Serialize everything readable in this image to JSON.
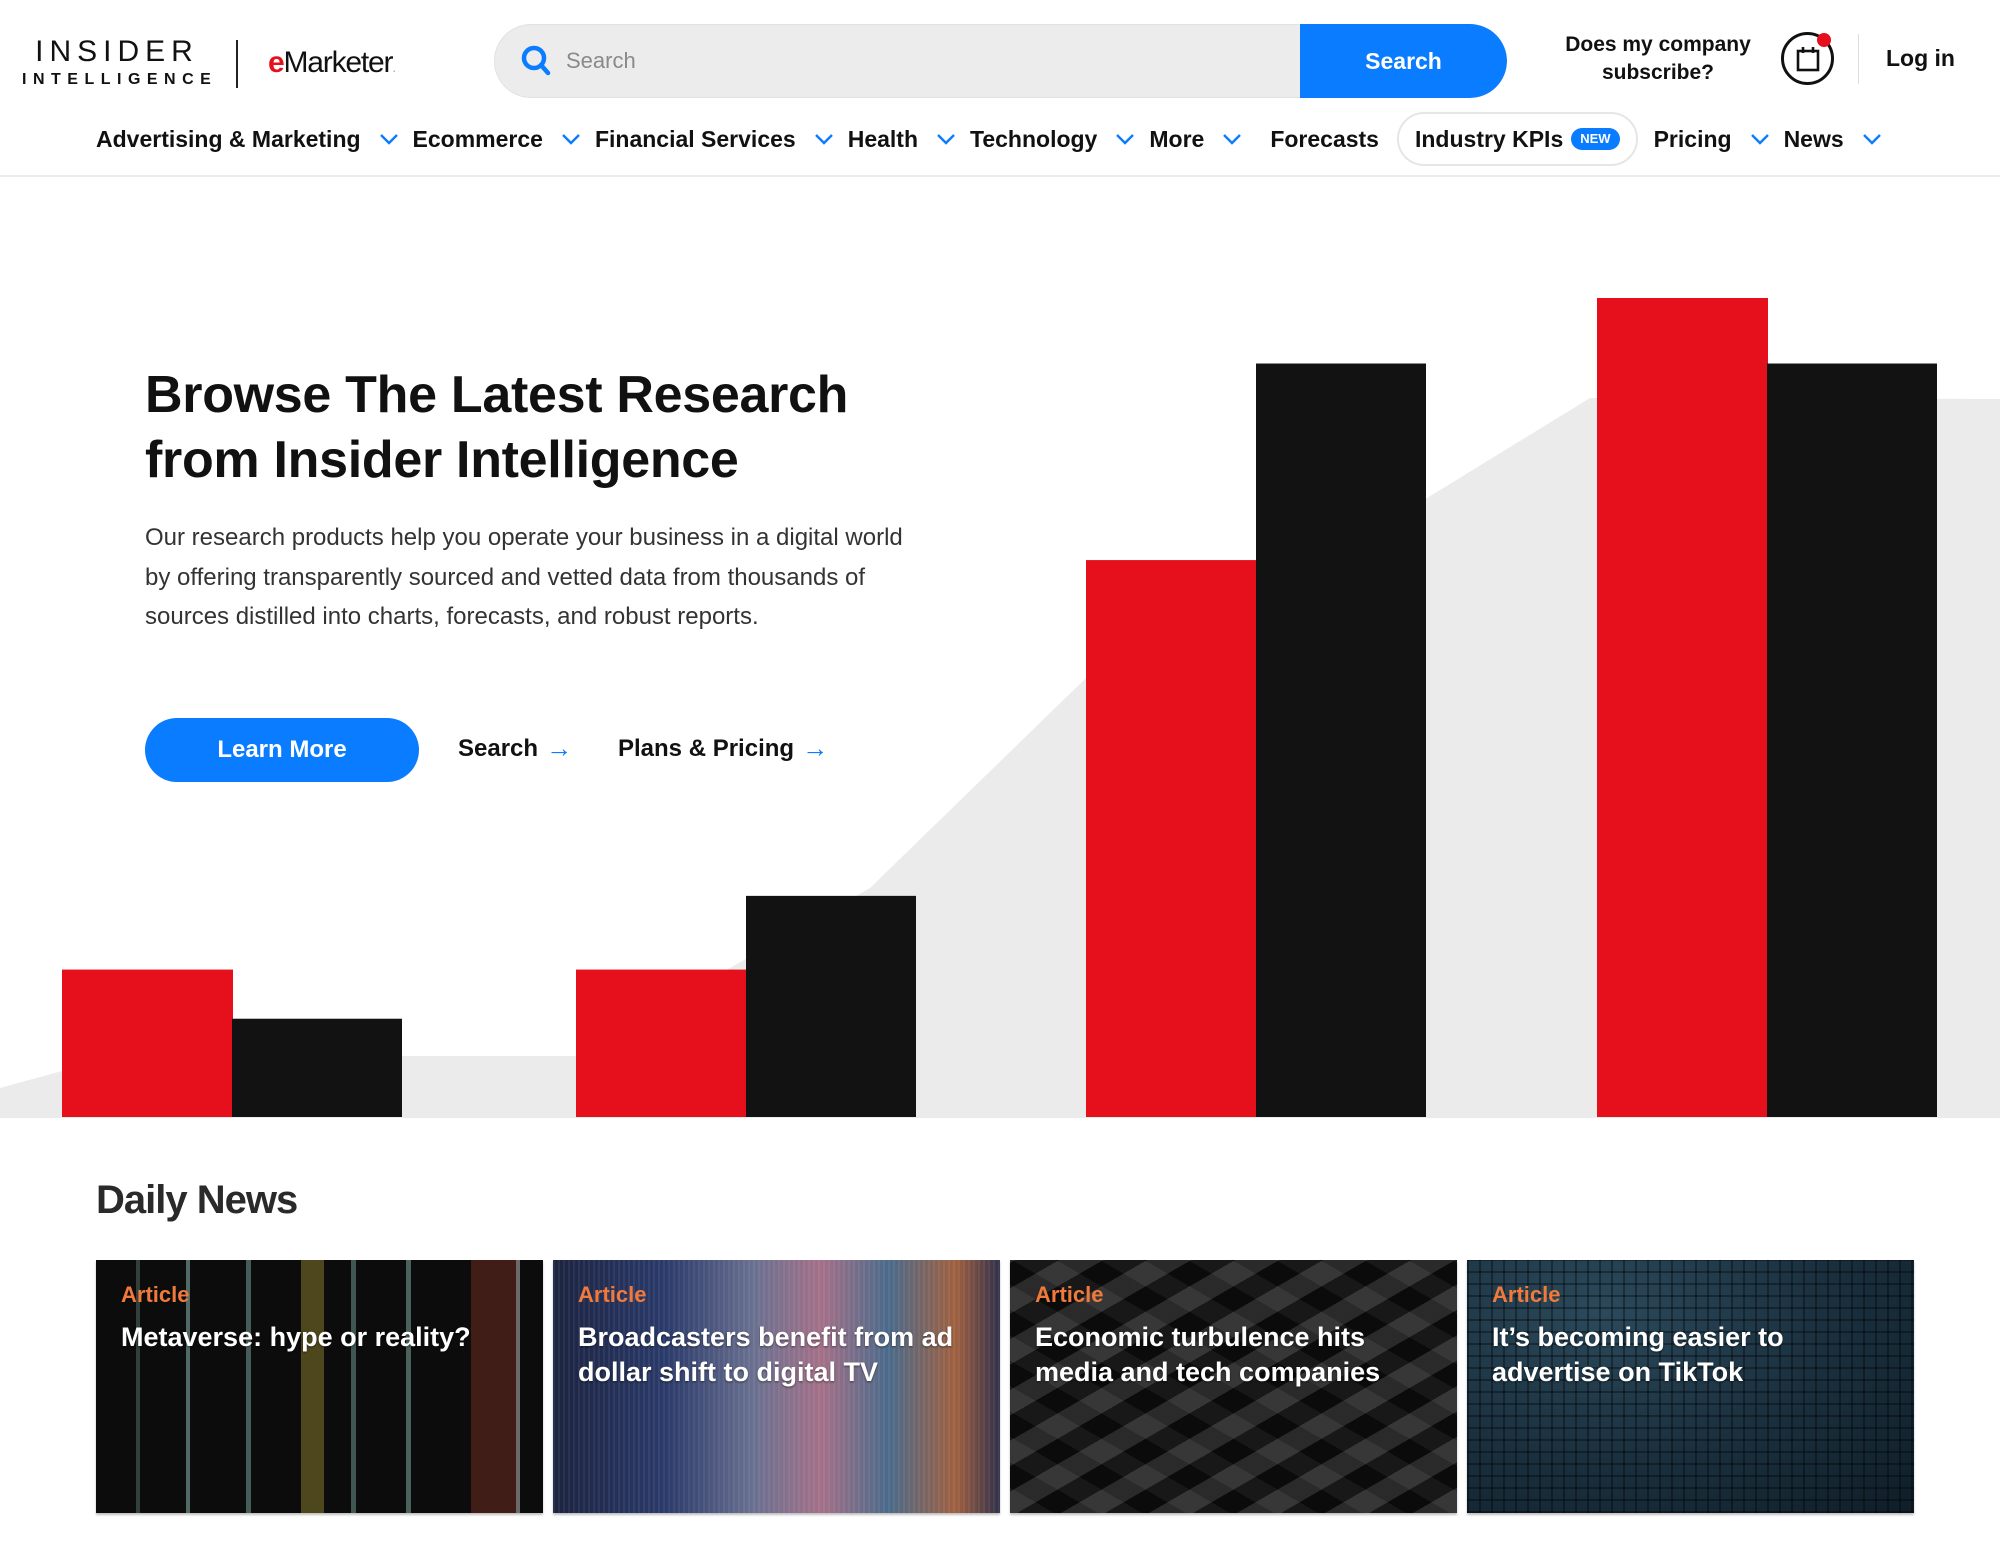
{
  "header": {
    "logo_primary_line1": "INSIDER",
    "logo_primary_line2": "INTELLIGENCE",
    "logo_secondary_e": "e",
    "logo_secondary_rest": "Marketer",
    "search_placeholder": "Search",
    "search_value": "",
    "search_button": "Search",
    "subscribe_line1": "Does my company",
    "subscribe_line2": "subscribe?",
    "calendar_icon": "calendar-icon",
    "notification_dot": true,
    "login": "Log in"
  },
  "nav": {
    "items": [
      {
        "label": "Advertising & Marketing",
        "dropdown": true
      },
      {
        "label": "Ecommerce",
        "dropdown": true
      },
      {
        "label": "Financial Services",
        "dropdown": true
      },
      {
        "label": "Health",
        "dropdown": true
      },
      {
        "label": "Technology",
        "dropdown": true
      },
      {
        "label": "More",
        "dropdown": true
      },
      {
        "label": "Forecasts",
        "dropdown": false
      },
      {
        "label": "Industry KPIs",
        "dropdown": false,
        "badge": "NEW",
        "highlighted": true
      },
      {
        "label": "Pricing",
        "dropdown": true
      },
      {
        "label": "News",
        "dropdown": true
      }
    ]
  },
  "hero": {
    "title_line1": "Browse The Latest Research",
    "title_line2": "from Insider Intelligence",
    "description": "Our research products help you operate your business in a digital world by offering transparently sourced and vetted data from thousands of sources distilled into charts, forecasts, and robust reports.",
    "primary_button": "Learn More",
    "link_search": "Search",
    "link_pricing": "Plans & Pricing",
    "arrow": "→"
  },
  "hero_graphic": {
    "groups": [
      {
        "red": 0.18,
        "black": 0.12
      },
      {
        "red": 0.18,
        "black": 0.27
      },
      {
        "red": 0.68,
        "black": 0.92
      },
      {
        "red": 1.0,
        "black": 0.92
      }
    ],
    "colors": {
      "red": "#e5101c",
      "black": "#121212",
      "backdrop": "#ebebeb"
    }
  },
  "daily_news": {
    "title": "Daily News",
    "cards": [
      {
        "tag": "Article",
        "title": "Metaverse: hype or reality?"
      },
      {
        "tag": "Article",
        "title": "Broadcasters benefit from ad dollar shift to digital TV"
      },
      {
        "tag": "Article",
        "title": "Economic turbulence hits media and tech companies"
      },
      {
        "tag": "Article",
        "title": "It’s becoming easier to advertise on TikTok"
      }
    ]
  },
  "colors": {
    "accent_blue": "#0a7cff",
    "brand_red": "#e5101c",
    "tag_orange": "#f07a3c"
  }
}
